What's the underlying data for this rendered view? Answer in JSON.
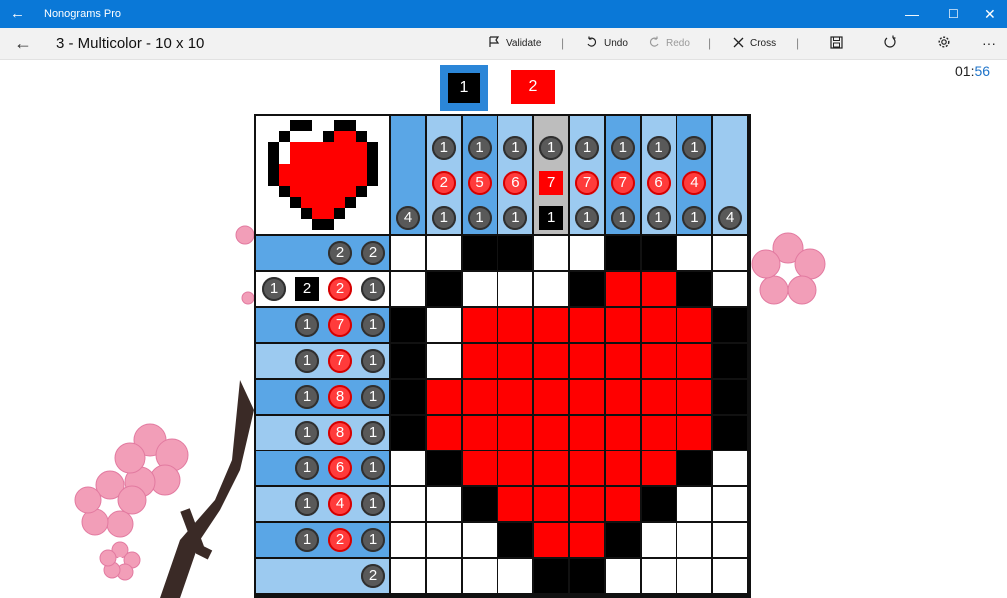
{
  "window": {
    "app_title": "Nonograms Pro",
    "back_glyph": "←",
    "minimize_glyph": "—",
    "maximize_glyph": "☐",
    "close_glyph": "✕"
  },
  "toolbar": {
    "back_glyph": "←",
    "puzzle_title": "3 - Multicolor - 10 x 10",
    "validate_label": "Validate",
    "undo_label": "Undo",
    "redo_label": "Redo",
    "cross_label": "Cross",
    "separator": "|",
    "more_glyph": "···",
    "icons": {
      "validate": "flag-icon",
      "undo": "undo-icon",
      "redo": "redo-icon",
      "cross": "cross-icon",
      "save": "save-icon",
      "reset": "reset-icon",
      "settings": "gear-icon",
      "more": "more-icon"
    }
  },
  "timer": {
    "minutes": "01:",
    "seconds": "56"
  },
  "palette": {
    "colors": [
      {
        "label": "1",
        "color": "#000000",
        "selected": true
      },
      {
        "label": "2",
        "color": "#ff0000",
        "selected": false
      }
    ]
  },
  "colors": {
    "black": "#000000",
    "red": "#ff0000",
    "white": "#ffffff",
    "clue_blue_dark": "#5aa6e6",
    "clue_blue_light": "#9ccaf0",
    "clue_gray": "#595959",
    "clue_red": "#ff3b3b",
    "titlebar_blue": "#0a78d7"
  },
  "column_clues": [
    [
      {
        "v": "4",
        "c": "gray"
      }
    ],
    [
      {
        "v": "1",
        "c": "gray"
      },
      {
        "v": "2",
        "c": "red"
      },
      {
        "v": "1",
        "c": "gray"
      }
    ],
    [
      {
        "v": "1",
        "c": "gray"
      },
      {
        "v": "5",
        "c": "red"
      },
      {
        "v": "1",
        "c": "gray"
      }
    ],
    [
      {
        "v": "1",
        "c": "gray"
      },
      {
        "v": "6",
        "c": "red"
      },
      {
        "v": "1",
        "c": "gray"
      }
    ],
    [
      {
        "v": "1",
        "c": "gray"
      },
      {
        "v": "7",
        "c": "red-sq"
      },
      {
        "v": "1",
        "c": "black-sq"
      }
    ],
    [
      {
        "v": "1",
        "c": "gray"
      },
      {
        "v": "7",
        "c": "red"
      },
      {
        "v": "1",
        "c": "gray"
      }
    ],
    [
      {
        "v": "1",
        "c": "gray"
      },
      {
        "v": "7",
        "c": "red"
      },
      {
        "v": "1",
        "c": "gray"
      }
    ],
    [
      {
        "v": "1",
        "c": "gray"
      },
      {
        "v": "6",
        "c": "red"
      },
      {
        "v": "1",
        "c": "gray"
      }
    ],
    [
      {
        "v": "1",
        "c": "gray"
      },
      {
        "v": "4",
        "c": "red"
      },
      {
        "v": "1",
        "c": "gray"
      }
    ],
    [
      {
        "v": "4",
        "c": "gray"
      }
    ]
  ],
  "row_clues": [
    [
      {
        "v": "2",
        "c": "gray"
      },
      {
        "v": "2",
        "c": "gray"
      }
    ],
    [
      {
        "v": "1",
        "c": "gray"
      },
      {
        "v": "2",
        "c": "black-sq"
      },
      {
        "v": "2",
        "c": "red"
      },
      {
        "v": "1",
        "c": "gray"
      }
    ],
    [
      {
        "v": "1",
        "c": "gray"
      },
      {
        "v": "7",
        "c": "red"
      },
      {
        "v": "1",
        "c": "gray"
      }
    ],
    [
      {
        "v": "1",
        "c": "gray"
      },
      {
        "v": "7",
        "c": "red"
      },
      {
        "v": "1",
        "c": "gray"
      }
    ],
    [
      {
        "v": "1",
        "c": "gray"
      },
      {
        "v": "8",
        "c": "red"
      },
      {
        "v": "1",
        "c": "gray"
      }
    ],
    [
      {
        "v": "1",
        "c": "gray"
      },
      {
        "v": "8",
        "c": "red"
      },
      {
        "v": "1",
        "c": "gray"
      }
    ],
    [
      {
        "v": "1",
        "c": "gray"
      },
      {
        "v": "6",
        "c": "red"
      },
      {
        "v": "1",
        "c": "gray"
      }
    ],
    [
      {
        "v": "1",
        "c": "gray"
      },
      {
        "v": "4",
        "c": "red"
      },
      {
        "v": "1",
        "c": "gray"
      }
    ],
    [
      {
        "v": "1",
        "c": "gray"
      },
      {
        "v": "2",
        "c": "red"
      },
      {
        "v": "1",
        "c": "gray"
      }
    ],
    [
      {
        "v": "2",
        "c": "gray"
      }
    ]
  ],
  "grid": [
    "WWBBWWBBWW",
    "WBWWWBRRBW",
    "BWRRRRRRRB",
    "BWRRRRRRRB",
    "BRRRRRRRRB",
    "BRRRRRRRRB",
    "WBRRRRRRBW",
    "WWBRRRRBWW",
    "WWWBRRBWWW",
    "WWWWBBWWWW"
  ]
}
